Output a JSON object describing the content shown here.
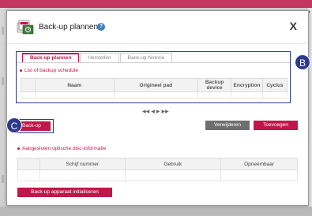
{
  "colors": {
    "accent": "#c0174a",
    "highlight": "#2d3a8c",
    "neutral_button": "#6e6e6e"
  },
  "dialog": {
    "title": "Back-up plannen",
    "help_icon": "?",
    "close_label": "X"
  },
  "tabs": [
    {
      "label": "Back-up plannen",
      "active": true
    },
    {
      "label": "Herstellen",
      "active": false
    },
    {
      "label": "Back-up historie",
      "active": false
    }
  ],
  "schedule": {
    "title": "List of backup schedule",
    "columns": [
      "",
      "Naam",
      "Origineel pad",
      "Backup device",
      "Encryption",
      "Cyclus"
    ],
    "rows": []
  },
  "pager": {
    "first": "◀◀",
    "prev": "◀",
    "next": "▶",
    "last": "▶▶"
  },
  "buttons": {
    "backup": "Back-up",
    "remove": "Verwijderen",
    "add": "Toevoegen",
    "init_device": "Back-up apparaat initialiseren"
  },
  "disc": {
    "title": "Aangesloten optische disc-informatie",
    "columns": [
      "",
      "Schijf nummer",
      "Gebruik",
      "Opneembaar"
    ],
    "rows": []
  },
  "annotations": {
    "b": "B",
    "c": "C"
  }
}
